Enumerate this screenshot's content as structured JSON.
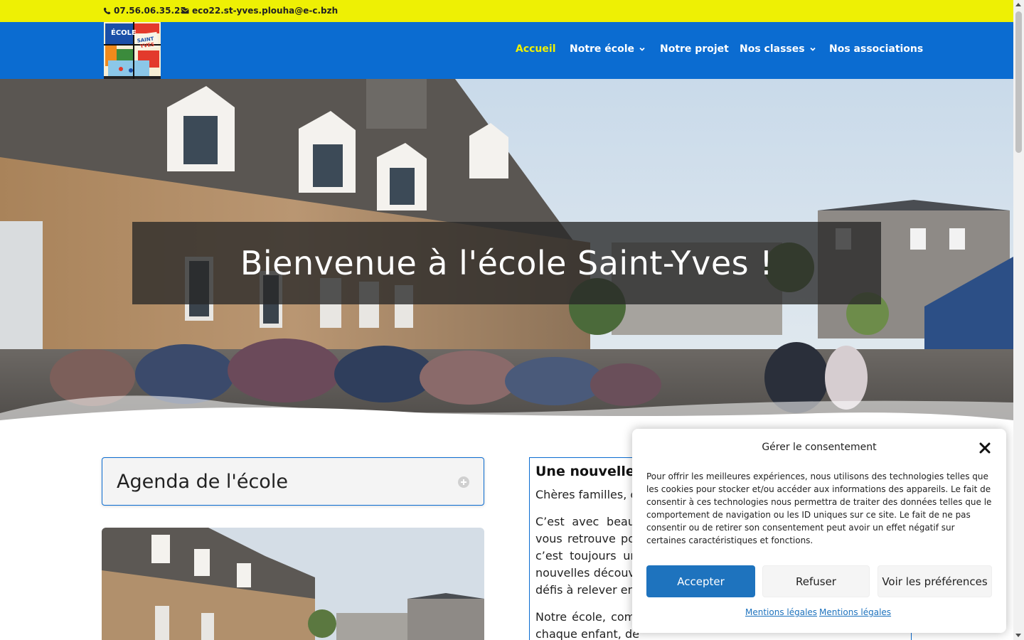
{
  "topbar": {
    "phone": "07.56.06.35.25",
    "email": "eco22.st-yves.plouha@e-c.bzh"
  },
  "header": {
    "logo_alt": "École Saint-Yves",
    "nav": [
      {
        "label": "Accueil",
        "active": true,
        "dropdown": false
      },
      {
        "label": "Notre école",
        "active": false,
        "dropdown": true
      },
      {
        "label": "Notre projet",
        "active": false,
        "dropdown": false
      },
      {
        "label": "Nos classes",
        "active": false,
        "dropdown": true
      },
      {
        "label": "Nos associations",
        "active": false,
        "dropdown": false
      }
    ]
  },
  "hero": {
    "title": "Bienvenue à l'école Saint-Yves !"
  },
  "toggle": {
    "title": "Agenda de l'école"
  },
  "article": {
    "heading": "Une nouvelle",
    "paragraphs": [
      "Chères familles, c",
      "C’est avec beau vous retrouve po c’est toujours ur nouvelles découv défis à relever en",
      "Notre école, com humaine où nous avons à cœur de connaître chaque enfant, de"
    ]
  },
  "cookie": {
    "title": "Gérer le consentement",
    "text": "Pour offrir les meilleures expériences, nous utilisons des technologies telles que les cookies pour stocker et/ou accéder aux informations des appareils. Le fait de consentir à ces technologies nous permettra de traiter des données telles que le comportement de navigation ou les ID uniques sur ce site. Le fait de ne pas consentir ou de retirer son consentement peut avoir un effet négatif sur certaines caractéristiques et fonctions.",
    "accept": "Accepter",
    "refuse": "Refuser",
    "preferences": "Voir les préférences",
    "link1": "Mentions légales",
    "link2": "Mentions légales"
  },
  "colors": {
    "topbar": "#eef004",
    "header": "#0b6cd1",
    "accent": "#1e73be"
  }
}
